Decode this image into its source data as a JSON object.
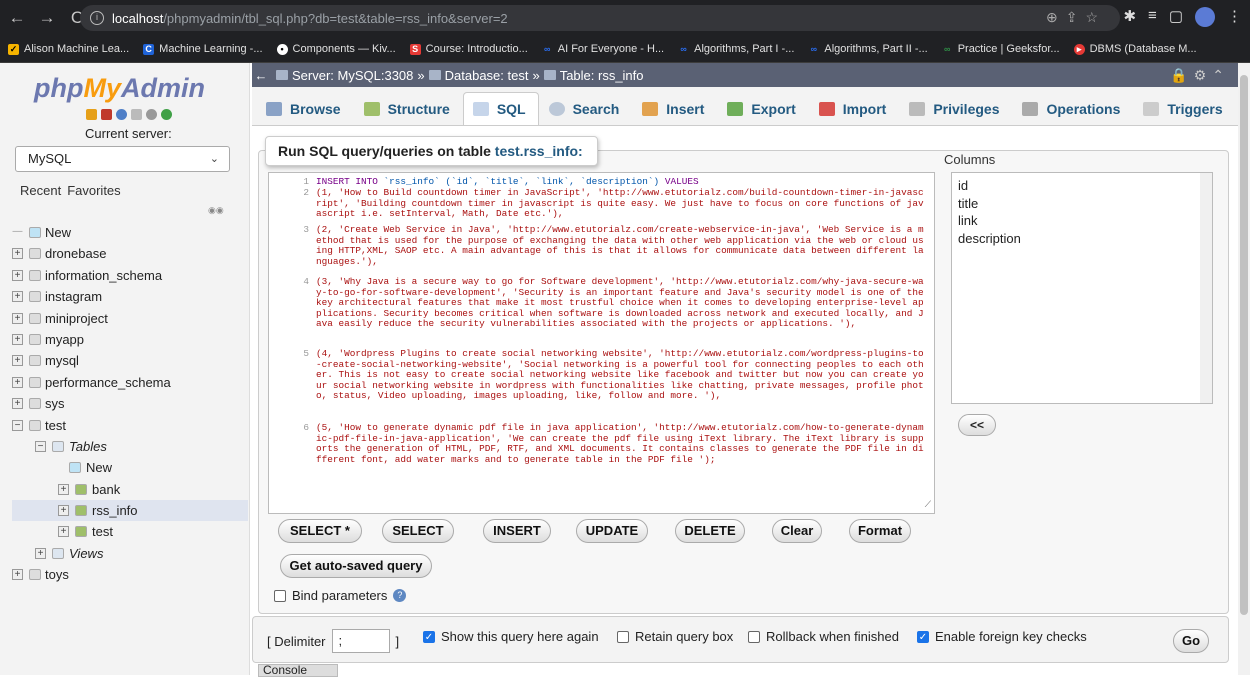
{
  "browser": {
    "url_host": "localhost",
    "url_path": "/phpmyadmin/tbl_sql.php?db=test&table=rss_info&server=2",
    "bookmarks": [
      "Alison Machine Lea...",
      "Machine Learning -...",
      "Components — Kiv...",
      "Course: Introductio...",
      "AI For Everyone - H...",
      "Algorithms, Part I -...",
      "Algorithms, Part II -...",
      "Practice | Geeksfor...",
      "DBMS (Database M..."
    ]
  },
  "sidebar": {
    "logo_php": "php",
    "logo_my": "My",
    "logo_admin": "Admin",
    "current_server_label": "Current server:",
    "server_value": "MySQL",
    "recent_label": "Recent",
    "favorites_label": "Favorites",
    "tree": {
      "new": "New",
      "dbs": [
        "dronebase",
        "information_schema",
        "instagram",
        "miniproject",
        "myapp",
        "mysql",
        "performance_schema",
        "sys",
        "test"
      ],
      "tables_label": "Tables",
      "tables_new": "New",
      "tables": [
        "bank",
        "rss_info",
        "test"
      ],
      "views_label": "Views",
      "last_db": "toys"
    }
  },
  "breadcrumb": {
    "server": "Server: MySQL:3308",
    "database": "Database: test",
    "table": "Table: rss_info"
  },
  "tabs": [
    "Browse",
    "Structure",
    "SQL",
    "Search",
    "Insert",
    "Export",
    "Import",
    "Privileges",
    "Operations",
    "Triggers"
  ],
  "sql": {
    "legend_prefix": "Run SQL query/queries on table ",
    "legend_table": "test.rss_info:",
    "lines": [
      {
        "n": "1",
        "pre": "INSERT INTO ",
        "ident": "`rss_info` (`id`, `title`, `link`, `description`)",
        "post": " VALUES"
      },
      {
        "n": "2",
        "text": "(1, 'How to Build countdown timer in JavaScript', 'http://www.etutorialz.com/build-countdown-timer-in-javascript', 'Building countdown timer in javascript is quite easy. We just have to focus on core functions of javascript i.e. setInterval, Math, Date etc.'),"
      },
      {
        "n": "3",
        "text": "(2, 'Create Web Service in Java', 'http://www.etutorialz.com/create-webservice-in-java', 'Web Service is a method that is used for the purpose of exchanging the data with other web application via the web or cloud using HTTP,XML, SAOP etc. A main advantage of this is that it allows for communicate data between different languages.'),"
      },
      {
        "n": "4",
        "text": "(3, 'Why Java is a secure way to go for Software development', 'http://www.etutorialz.com/why-java-secure-way-to-go-for-software-development', 'Security is an important feature and Java's security model is one of the key architectural features that make it most trustful choice when it comes to developing enterprise-level applications. Security becomes critical when software is downloaded across network and executed locally, and Java easily reduce the security vulnerabilities associated with the projects or applications. '),"
      },
      {
        "n": "5",
        "text": "(4, 'Wordpress Plugins to create social networking website', 'http://www.etutorialz.com/wordpress-plugins-to-create-social-networking-website', 'Social networking is a powerful tool for connecting peoples to each other. This is not easy to create social networking website like facebook and twitter but now you can create your social networking website in wordpress with functionalities like chatting, private messages, profile photo, status, Video uploading, images uploading, like, follow and more. '),"
      },
      {
        "n": "6",
        "text": "(5, 'How to generate dynamic pdf file in java application', 'http://www.etutorialz.com/how-to-generate-dynamic-pdf-file-in-java-application', 'We can create the pdf file using iText library. The iText library is supports the generation of HTML, PDF, RTF, and XML documents. It contains classes to generate the PDF file in different font, add water marks and to generate table in the PDF file ');"
      }
    ],
    "columns_label": "Columns",
    "columns": [
      "id",
      "title",
      "link",
      "description"
    ],
    "insert_col_btn": "<<",
    "buttons": [
      "SELECT *",
      "SELECT",
      "INSERT",
      "UPDATE",
      "DELETE",
      "Clear",
      "Format"
    ],
    "autosaved_btn": "Get auto-saved query",
    "bind_params": "Bind parameters"
  },
  "options": {
    "delimiter_label": "[ Delimiter",
    "delimiter_value": ";",
    "delimiter_close": "]",
    "show_query": "Show this query here again",
    "retain_box": "Retain query box",
    "rollback": "Rollback when finished",
    "foreign_keys": "Enable foreign key checks",
    "go": "Go"
  },
  "console_label": "Console"
}
